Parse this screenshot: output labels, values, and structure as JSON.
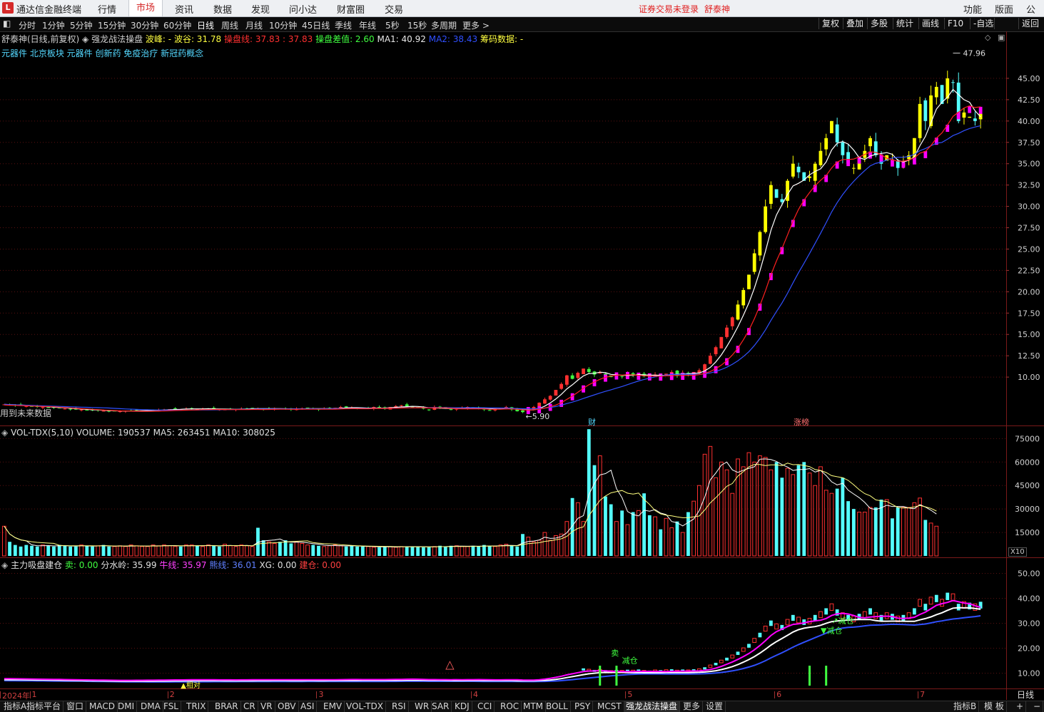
{
  "app": {
    "name": "通达信金融终端",
    "menus": [
      "行情",
      "市场",
      "资讯",
      "数据",
      "发现",
      "问小达",
      "财富圈",
      "交易"
    ],
    "active_menu": "市场",
    "login_warning": "证券交易未登录",
    "stock_name_top": "舒泰神",
    "right_menus": [
      "功能",
      "版面",
      "公式"
    ]
  },
  "toolbar": {
    "periods": [
      "分时",
      "1分钟",
      "5分钟",
      "15分钟",
      "30分钟",
      "60分钟",
      "日线",
      "周线",
      "月线",
      "10分钟",
      "45日线",
      "季线",
      "年线",
      "5秒",
      "15秒",
      "多周期",
      "更多 >"
    ],
    "active_period": "日线",
    "right_buttons": [
      "复权",
      "叠加",
      "多股",
      "统计",
      "画线",
      "F10",
      "-自选",
      "返回"
    ]
  },
  "main_chart": {
    "header": {
      "title": "舒泰神(日线,前复权)",
      "indicator": "强龙战法操盘",
      "wave_peak_label": "波峰: -",
      "wave_trough_label": "波谷: 31.78",
      "op_line_label": "操盘线: 37.83 : 37.83",
      "op_diff_label": "操盘差值: 2.60",
      "ma1_label": "MA1: 40.92",
      "ma2_label": "MA2: 38.43",
      "chips_label": "筹码数据: -"
    },
    "concepts": "元器件 北京板块 元器件 创新药 免疫治疗 新冠药概念",
    "future_note": "用到未来数据",
    "high_marker": "47.96",
    "low_marker": "5.90",
    "badges": [
      "财",
      "涨榜"
    ],
    "colors": {
      "ma1": "#ffffff",
      "ma2": "#3050ff",
      "red_line": "#ff2020",
      "up_yellow": "#ffff00",
      "down_cyan": "#54ffff",
      "magenta": "#ff00ff"
    }
  },
  "chart_data": [
    {
      "type": "candlestick",
      "title": "舒泰神(日线,前复权)",
      "ylim": [
        5.0,
        48.0
      ],
      "y_ticks": [
        10.0,
        12.5,
        15.0,
        17.5,
        20.0,
        22.5,
        25.0,
        27.5,
        30.0,
        32.5,
        35.0,
        37.5,
        40.0,
        42.5,
        45.0
      ],
      "x_month_labels": [
        "2024年",
        "1",
        "2",
        "3",
        "4",
        "5",
        "6",
        "7"
      ],
      "close": [
        6.8,
        6.75,
        6.7,
        6.65,
        6.6,
        6.55,
        6.5,
        6.5,
        6.45,
        6.4,
        6.35,
        6.3,
        6.25,
        6.2,
        6.2,
        6.15,
        6.1,
        6.1,
        6.05,
        6.0,
        6.0,
        6.0,
        6.05,
        6.05,
        6.1,
        6.1,
        6.1,
        6.15,
        6.15,
        6.2,
        6.25,
        6.3,
        6.25,
        6.3,
        6.3,
        6.25,
        6.3,
        6.3,
        6.25,
        6.2,
        6.2,
        6.25,
        6.25,
        6.3,
        6.3,
        6.35,
        6.3,
        6.25,
        6.3,
        6.35,
        6.3,
        6.25,
        6.2,
        6.3,
        6.35,
        6.4,
        6.3,
        6.2,
        6.3,
        6.35,
        6.4,
        6.5,
        6.45,
        6.4,
        6.35,
        6.3,
        6.35,
        6.5,
        6.4,
        6.3,
        6.5,
        6.6,
        6.7,
        6.6,
        6.5,
        6.4,
        6.3,
        6.2,
        6.5,
        6.4,
        6.3,
        6.2,
        6.3,
        6.4,
        6.5,
        6.4,
        6.3,
        6.2,
        6.1,
        6.3,
        6.4,
        6.5,
        6.2,
        6.0,
        5.9,
        6.2,
        6.5,
        7.0,
        7.4,
        7.8,
        8.5,
        9.2,
        10.2,
        9.8,
        10.5,
        11.0,
        10.6,
        10.3,
        10.5,
        10.2,
        10.0,
        10.3,
        10.1,
        10.4,
        10.2,
        10.5,
        10.1,
        10.0,
        10.3,
        10.2,
        10.4,
        10.6,
        10.2,
        10.5,
        10.3,
        10.6,
        10.8,
        11.5,
        12.5,
        13.5,
        14.7,
        15.8,
        17.0,
        18.5,
        20.2,
        22.0,
        24.5,
        27.0,
        30.0,
        32.5,
        31.0,
        30.5,
        33.0,
        35.0,
        34.0,
        33.0,
        33.5,
        35.0,
        36.5,
        38.0,
        40.0,
        37.5,
        36.0,
        35.0,
        34.5,
        35.5,
        36.5,
        38.0,
        36.0,
        35.0,
        36.0,
        35.5,
        34.5,
        35.0,
        36.0,
        38.0,
        42.0,
        40.0,
        43.0,
        44.0,
        42.0,
        45.0,
        44.5,
        40.0,
        41.0,
        40.5,
        40.0,
        40.92
      ],
      "ma1": [],
      "ma2": []
    },
    {
      "type": "bar",
      "title": "VOL-TDX(5,10)",
      "labels": {
        "volume": "VOLUME: 190537",
        "ma5": "MA5: 263451",
        "ma10": "MA10: 308025"
      },
      "ylim": [
        0,
        82000
      ],
      "y_ticks": [
        15000,
        30000,
        45000,
        60000,
        75000
      ],
      "unit": "X10",
      "values": [
        19000,
        9000,
        7000,
        6000,
        7000,
        6500,
        6000,
        7000,
        6500,
        6000,
        7000,
        6500,
        6000,
        6000,
        7000,
        6500,
        6000,
        6500,
        7000,
        6000,
        6000,
        6500,
        6000,
        7000,
        6500,
        6000,
        6000,
        7000,
        6500,
        7000,
        6500,
        6000,
        6000,
        7000,
        7000,
        6500,
        6000,
        7000,
        6500,
        6000,
        7500,
        6500,
        6000,
        7000,
        6500,
        6000,
        18000,
        10000,
        9000,
        8000,
        9000,
        10000,
        8000,
        9000,
        8000,
        7000,
        7000,
        6500,
        6000,
        6500,
        7000,
        6500,
        6000,
        6500,
        6000,
        6000,
        6000,
        5500,
        5500,
        6000,
        6000,
        5500,
        6000,
        6000,
        6000,
        6000,
        5500,
        5500,
        6000,
        6500,
        6000,
        6500,
        6500,
        6000,
        6000,
        6500,
        6000,
        7000,
        6500,
        6000,
        7000,
        7500,
        6500,
        6000,
        14000,
        12000,
        9000,
        10000,
        15000,
        10000,
        13000,
        14000,
        22000,
        37000,
        34000,
        22000,
        81000,
        58000,
        64000,
        38000,
        33000,
        22000,
        29000,
        20000,
        28000,
        29000,
        40000,
        26000,
        25000,
        17000,
        24000,
        18000,
        22000,
        15000,
        28000,
        35000,
        45000,
        65000,
        70000,
        50000,
        60000,
        55000,
        40000,
        62000,
        57000,
        66000,
        60000,
        64000,
        63000,
        55000,
        60000,
        50000,
        56000,
        52000,
        58000,
        60000,
        53000,
        45000,
        57000,
        42000,
        40000,
        43000,
        50000,
        35000,
        30000,
        28000,
        28000,
        31000,
        31000,
        36000,
        36000,
        24000,
        31000,
        31000,
        31000,
        34000,
        37000,
        23000,
        21000,
        19000
      ],
      "up": []
    },
    {
      "type": "line",
      "title": "主力吸盘建仓",
      "labels": {
        "sell": "卖: 0.00",
        "watershed": "分水岭: 35.99",
        "bull": "牛线: 35.97",
        "bear": "熊线: 36.01",
        "xg": "XG: 0.00",
        "build": "建仓: 0.00"
      },
      "ylim": [
        5,
        55
      ],
      "y_ticks": [
        10.0,
        20.0,
        30.0,
        40.0,
        50.0
      ],
      "annotations": [
        "相对",
        "卖",
        "减仓",
        "减仓",
        "减仓"
      ]
    }
  ],
  "bottom_tabs": {
    "items": [
      "指标A",
      "指标平台",
      "窗口",
      "MACD",
      "DMI",
      "DMA",
      "FSL",
      "TRIX",
      "BRAR",
      "CR",
      "VR",
      "OBV",
      "ASI",
      "EMV",
      "VOL-TDX",
      "RSI",
      "WR",
      "SAR",
      "KDJ",
      "CCI",
      "ROC",
      "MTM",
      "BOLL",
      "PSY",
      "MCST",
      "强龙战法操盘",
      "更多",
      "设置"
    ],
    "active": "强龙战法操盘",
    "right_items": [
      "指标B",
      "模 板",
      "+",
      "−"
    ],
    "period_btn": "日线"
  }
}
